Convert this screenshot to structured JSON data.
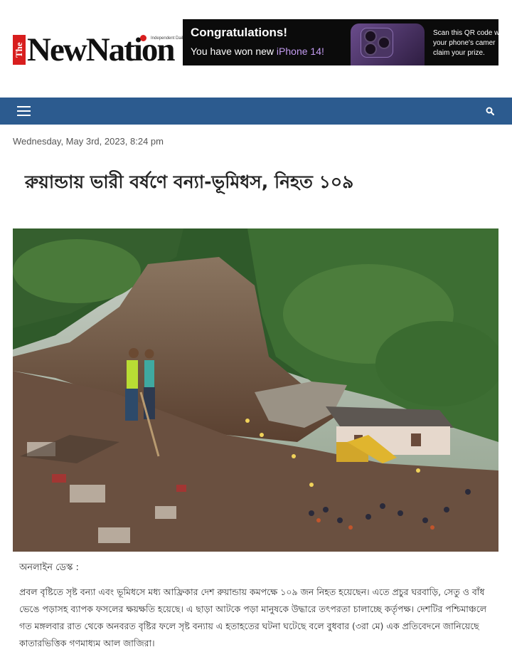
{
  "brand": {
    "the": "The",
    "name": "NewNation",
    "tagline": "Independent Daily",
    "accent_color": "#d81e1e"
  },
  "ad": {
    "headline": "Congratulations!",
    "subline_prefix": "You have won new ",
    "subline_highlight": "iPhone 14!",
    "qr_line1": "Scan this QR code w",
    "qr_line2": "your phone's camer",
    "qr_line3": "claim your prize."
  },
  "nav": {
    "menu_icon": "hamburger-menu-icon",
    "search_icon": "search-icon",
    "bar_color": "#2c5b8f"
  },
  "article": {
    "date": "Wednesday, May 3rd, 2023, 8:24 pm",
    "headline": "রুয়ান্ডায় ভারী বর্ষণে বন্যা-ভূমিধস, নিহত ১০৯",
    "desk": "অনলাইন ডেস্ক :",
    "body": "প্রবল বৃষ্টিতে সৃষ্ট বন্যা এবং ভূমিধসে মধ্য আফ্রিকার দেশ রুয়ান্ডায় কমপক্ষে ১০৯ জন নিহত হয়েছেন। এতে প্রচুর ঘরবাড়ি, সেতু ও বাঁধ ভেঙে পড়াসহ ব্যাপক ফসলের ক্ষয়ক্ষতি হয়েছে। এ ছাড়া আটকে পড়া মানুষকে উদ্ধারে তৎপরতা চালাচ্ছে কর্তৃপক্ষ। দেশটির পশ্চিমাঞ্চলে গত মঙ্গলবার রাত থেকে অনবরত বৃষ্টির ফলে সৃষ্ট বন্যায় এ হতাহতের ঘটনা ঘটেছে বলে বুধবার (৩রা মে) এক প্রতিবেদনে জানিয়েছে কাতারভিত্তিক গণমাধ্যম আল জাজিরা।"
  }
}
